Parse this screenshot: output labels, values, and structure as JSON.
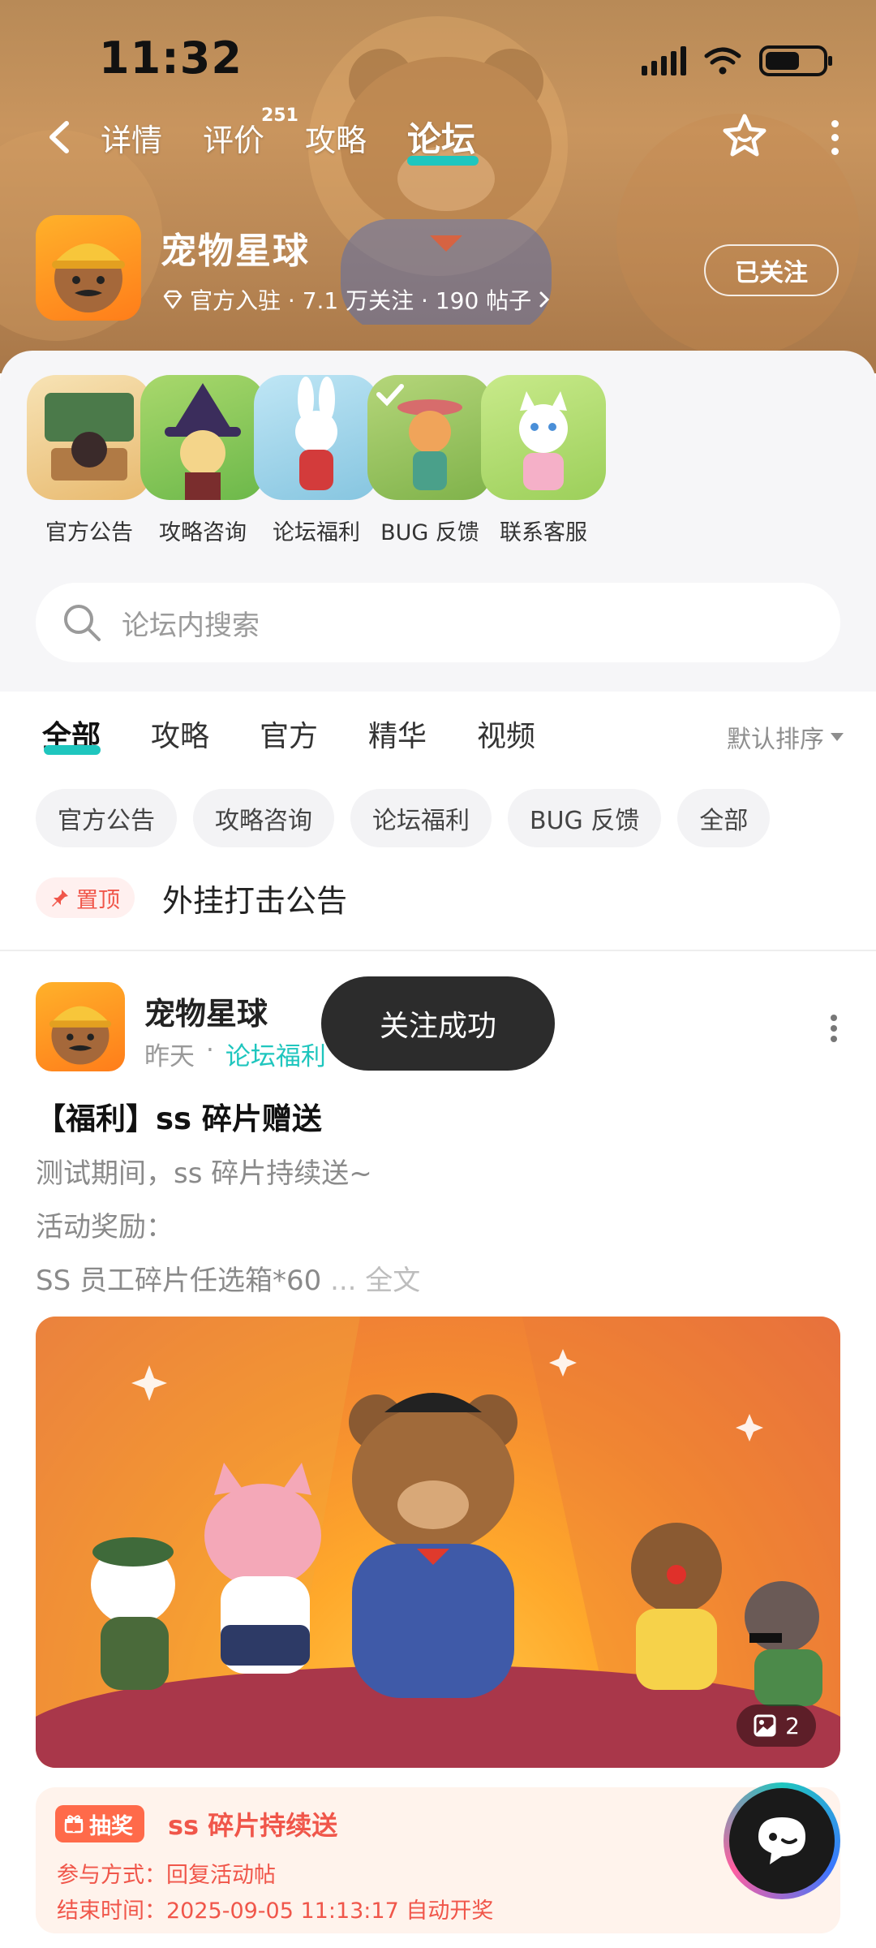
{
  "status_bar": {
    "time": "11:32",
    "network": "6"
  },
  "nav": {
    "tabs": [
      {
        "label": "详情"
      },
      {
        "label": "评价",
        "badge": "251"
      },
      {
        "label": "攻略"
      },
      {
        "label": "论坛"
      }
    ],
    "active_tab": "论坛"
  },
  "game": {
    "name": "宠物星球",
    "meta": "官方入驻 · 7.1 万关注 · 190 帖子",
    "follow_label": "已关注"
  },
  "categories": [
    {
      "label": "官方公告"
    },
    {
      "label": "攻略咨询"
    },
    {
      "label": "论坛福利"
    },
    {
      "label": "BUG 反馈"
    },
    {
      "label": "联系客服"
    }
  ],
  "search": {
    "placeholder": "论坛内搜索"
  },
  "filter_tabs": [
    {
      "label": "全部"
    },
    {
      "label": "攻略"
    },
    {
      "label": "官方"
    },
    {
      "label": "精华"
    },
    {
      "label": "视频"
    }
  ],
  "sort_label": "默认排序",
  "chips": [
    "官方公告",
    "攻略咨询",
    "论坛福利",
    "BUG 反馈",
    "全部"
  ],
  "pinned": {
    "tag": "置顶",
    "text": "外挂打击公告"
  },
  "post": {
    "author": "宠物星球",
    "time": "昨天",
    "section": "论坛福利",
    "title": "【福利】ss 碎片赠送",
    "lines": [
      "测试期间，ss 碎片持续送~",
      "活动奖励：",
      "SS 员工碎片任选箱*60"
    ],
    "more_label": "... 全文",
    "image_count": "2"
  },
  "toast": "关注成功",
  "lottery": {
    "tag": "抽奖",
    "title": "ss 碎片持续送",
    "method": "参与方式：回复活动帖",
    "end_time": "结束时间：2025-09-05 11:13:17 自动开奖"
  },
  "colors": {
    "accent": "#1fc6be",
    "red": "#f0564a"
  }
}
